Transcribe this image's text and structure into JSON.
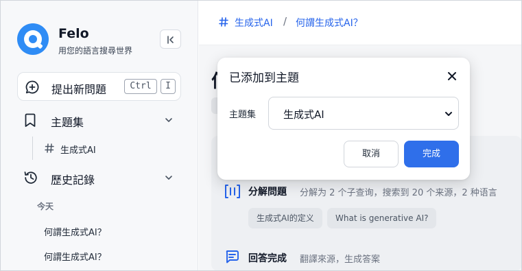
{
  "brand": {
    "name": "Felo",
    "tagline": "用您的語言搜尋世界"
  },
  "sidebar": {
    "new_question": {
      "label": "提出新問題",
      "shortcut_keys": [
        "Ctrl",
        "I"
      ]
    },
    "topics": {
      "label": "主題集",
      "items": [
        {
          "label": "生成式AI"
        }
      ]
    },
    "history": {
      "label": "歷史記錄",
      "group_label": "今天",
      "items": [
        {
          "label": "何謂生成式AI？"
        },
        {
          "label": "何謂生成式AI？"
        }
      ]
    }
  },
  "breadcrumb": {
    "topic": "生成式AI",
    "separator": "/",
    "question": "何謂生成式AI？"
  },
  "main": {
    "title_partial": "何",
    "steps": [
      {
        "title": "分解問題",
        "desc": "分解为 2 个子查询，搜索到 20 个来源，2 种语言"
      },
      {
        "title": "回答完成",
        "desc": "翻譯來源，生成答案"
      }
    ],
    "queries": [
      "生成式AI的定义",
      "What is generative AI?"
    ]
  },
  "dialog": {
    "title": "已添加到主題",
    "field_label": "主題集",
    "selected_topic": "生成式AI",
    "cancel_label": "取消",
    "confirm_label": "完成"
  },
  "colors": {
    "accent": "#2f6fea",
    "logo": "#2f8cf5",
    "link": "#2563eb"
  }
}
